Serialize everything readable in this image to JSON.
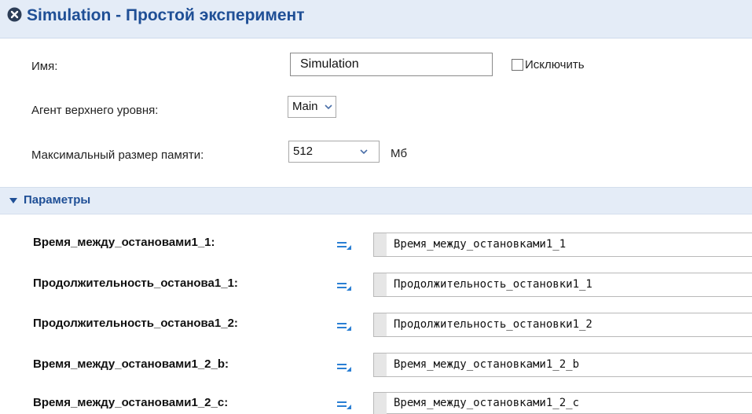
{
  "window": {
    "title": "Simulation - Простой эксперимент",
    "close_icon": "close-circle-x-icon"
  },
  "form": {
    "name_label": "Имя:",
    "name_value": "Simulation",
    "exclude_label": "Исключить",
    "exclude_checked": false,
    "top_agent_label": "Агент верхнего уровня:",
    "top_agent_value": "Main",
    "memory_label": "Максимальный размер памяти:",
    "memory_value": "512",
    "memory_unit": "Мб"
  },
  "parameters": {
    "section_title": "Параметры",
    "rows": [
      {
        "label": "Время_между_остановами1_1:",
        "value": "Время_между_остановками1_1"
      },
      {
        "label": "Продолжительность_останова1_1:",
        "value": "Продолжительность_остановки1_1"
      },
      {
        "label": "Продолжительность_останова1_2:",
        "value": "Продолжительность_остановки1_2"
      },
      {
        "label": "Время_между_остановами1_2_b:",
        "value": "Время_между_остановками1_2_b"
      },
      {
        "label": "Время_между_остановами1_2_c:",
        "value": "Время_между_остановками1_2_c"
      }
    ]
  },
  "colors": {
    "accent": "#1f4f96",
    "header_bg": "#e4ecf7",
    "equals_icon": "#2a7fd4"
  }
}
